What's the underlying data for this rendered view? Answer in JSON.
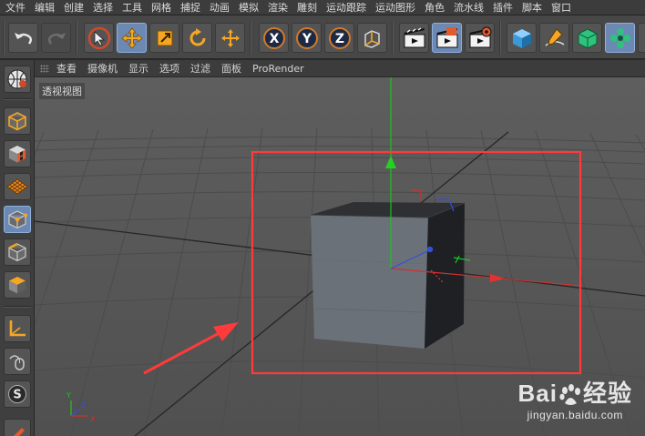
{
  "menu": [
    "文件",
    "编辑",
    "创建",
    "选择",
    "工具",
    "网格",
    "捕捉",
    "动画",
    "模拟",
    "渲染",
    "雕刻",
    "运动跟踪",
    "运动图形",
    "角色",
    "流水线",
    "插件",
    "脚本",
    "窗口"
  ],
  "toolbar": {
    "axis_x": "X",
    "axis_y": "Y",
    "axis_z": "Z"
  },
  "viewport_menu": [
    "查看",
    "摄像机",
    "显示",
    "选项",
    "过滤",
    "面板",
    "ProRender"
  ],
  "viewport": {
    "label": "透视视图",
    "axes": {
      "x": "X",
      "y": "Y",
      "z": "Z"
    }
  },
  "watermark": {
    "logo_latin": "Bai",
    "logo_cn": "经验",
    "url": "jingyan.baidu.com"
  },
  "colors": {
    "accent": "#6b89b3",
    "highlight_box": "#ff3a3a",
    "axis_x": "#e03030",
    "axis_y": "#21c421",
    "axis_z": "#3050e0"
  }
}
